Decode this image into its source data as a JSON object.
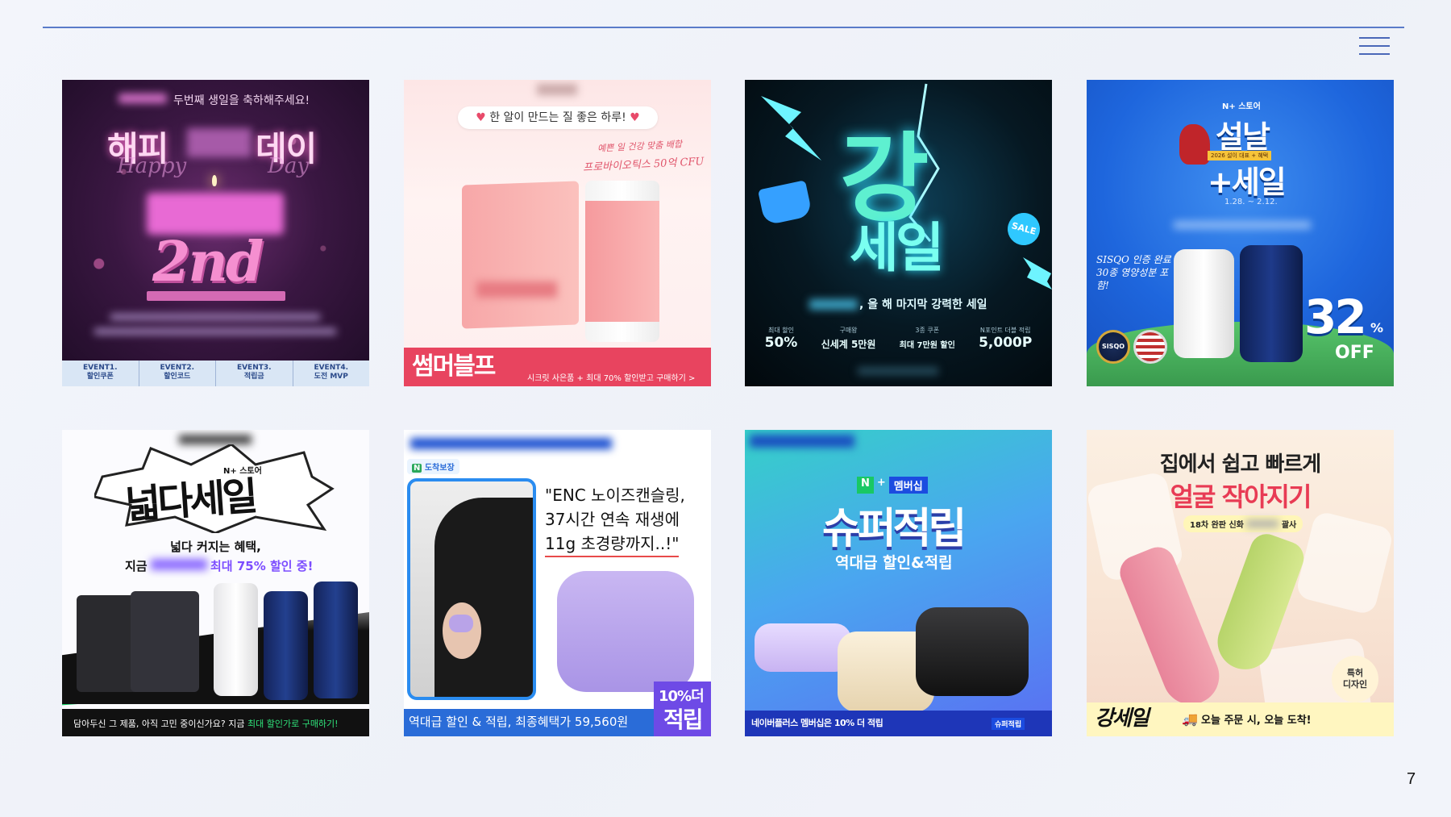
{
  "page_number": "7",
  "menu_icon": "hamburger-menu-icon",
  "tiles": [
    {
      "id": "t1",
      "headline": "두번째 생일을 축하해주세요!",
      "title_left": "해피",
      "title_right": "데이",
      "script": "Happy",
      "script_right": "Day",
      "big_number": "2nd",
      "events": [
        {
          "top": "EVENT1.",
          "bottom": "할인쿠폰"
        },
        {
          "top": "EVENT2.",
          "bottom": "할인코드"
        },
        {
          "top": "EVENT3.",
          "bottom": "적립금"
        },
        {
          "top": "EVENT4.",
          "bottom": "도전 MVP"
        }
      ]
    },
    {
      "id": "t2",
      "pill": "한 알이 만드는 질 좋은 하루!",
      "pill_highlight": "질 좋은 하루!",
      "handwrite_1": "예쁜 일 건강 맞춤 배합",
      "handwrite_2": "프로바이오틱스 50억 CFU",
      "brand": "썸머블프",
      "footer": "시크릿 사은품 + 최대 70% 할인받고 구매하기 >"
    },
    {
      "id": "t3",
      "big_1": "강",
      "big_2": "세일",
      "sale_badge": "SALE",
      "subline": ", 올 해 마지막 강력한 세일",
      "stats": [
        {
          "label": "최대 할인",
          "value": "50%"
        },
        {
          "label": "구매왕",
          "value": "신세계 5만원"
        },
        {
          "label": "3종 쿠폰",
          "value": "최대 7만원 할인"
        },
        {
          "label": "N포인트 더블 적립",
          "value": "5,000P"
        }
      ]
    },
    {
      "id": "t4",
      "store_badge": "N+ 스토어",
      "title_1": "설날",
      "title_2": "+세일",
      "ribbon": "2026 설이 대표 + 혜택",
      "dates": "1.28. ~ 2.12.",
      "handwrite": "SISQO 인증 완료 30종 영양성분 포함!",
      "seal": "SISQO",
      "percent": "32",
      "percent_unit": "%",
      "off": "OFF"
    },
    {
      "id": "t5",
      "store_badge": "N+ 스토어",
      "title": "넓다세일",
      "line_1": "넓다 커지는 혜택,",
      "line_2_prefix": "지금",
      "line_2_highlight": "최대 75% 할인 중!",
      "footer_prefix": "담아두신 그 제품, 아직 고민 중이신가요? 지금",
      "footer_highlight": "최대 할인가로 구매하기!"
    },
    {
      "id": "t6",
      "badge": "도착보장",
      "quote_1": "\"ENC 노이즈캔슬링,",
      "quote_2": "37시간 연속 재생에",
      "quote_3": "11g 초경량까지..!\"",
      "footer": "역대급 할인 & 적립, 최종혜택가 59,560원",
      "corner_1": "10%더",
      "corner_2": "적립"
    },
    {
      "id": "t7",
      "membership_badge": "멤버십",
      "title": "슈퍼적립",
      "subtitle": "역대급 할인&적립",
      "footer": "네이버플러스 멤버십은 10% 더 적립",
      "footer_tag": "슈퍼적립"
    },
    {
      "id": "t8",
      "title_1": "집에서 쉽고 빠르게",
      "title_2": "얼굴 작아지기",
      "pill_prefix": "18차 완판 신화",
      "pill_suffix": "괄사",
      "badge_1": "특허",
      "badge_2": "디자인",
      "brand": "강세일",
      "footer": "오늘 주문 시, 오늘 도착!"
    }
  ],
  "colors": {
    "rule": "#5a7bc9",
    "accent_pink": "#e83b6b",
    "accent_purple": "#7c4dff"
  }
}
